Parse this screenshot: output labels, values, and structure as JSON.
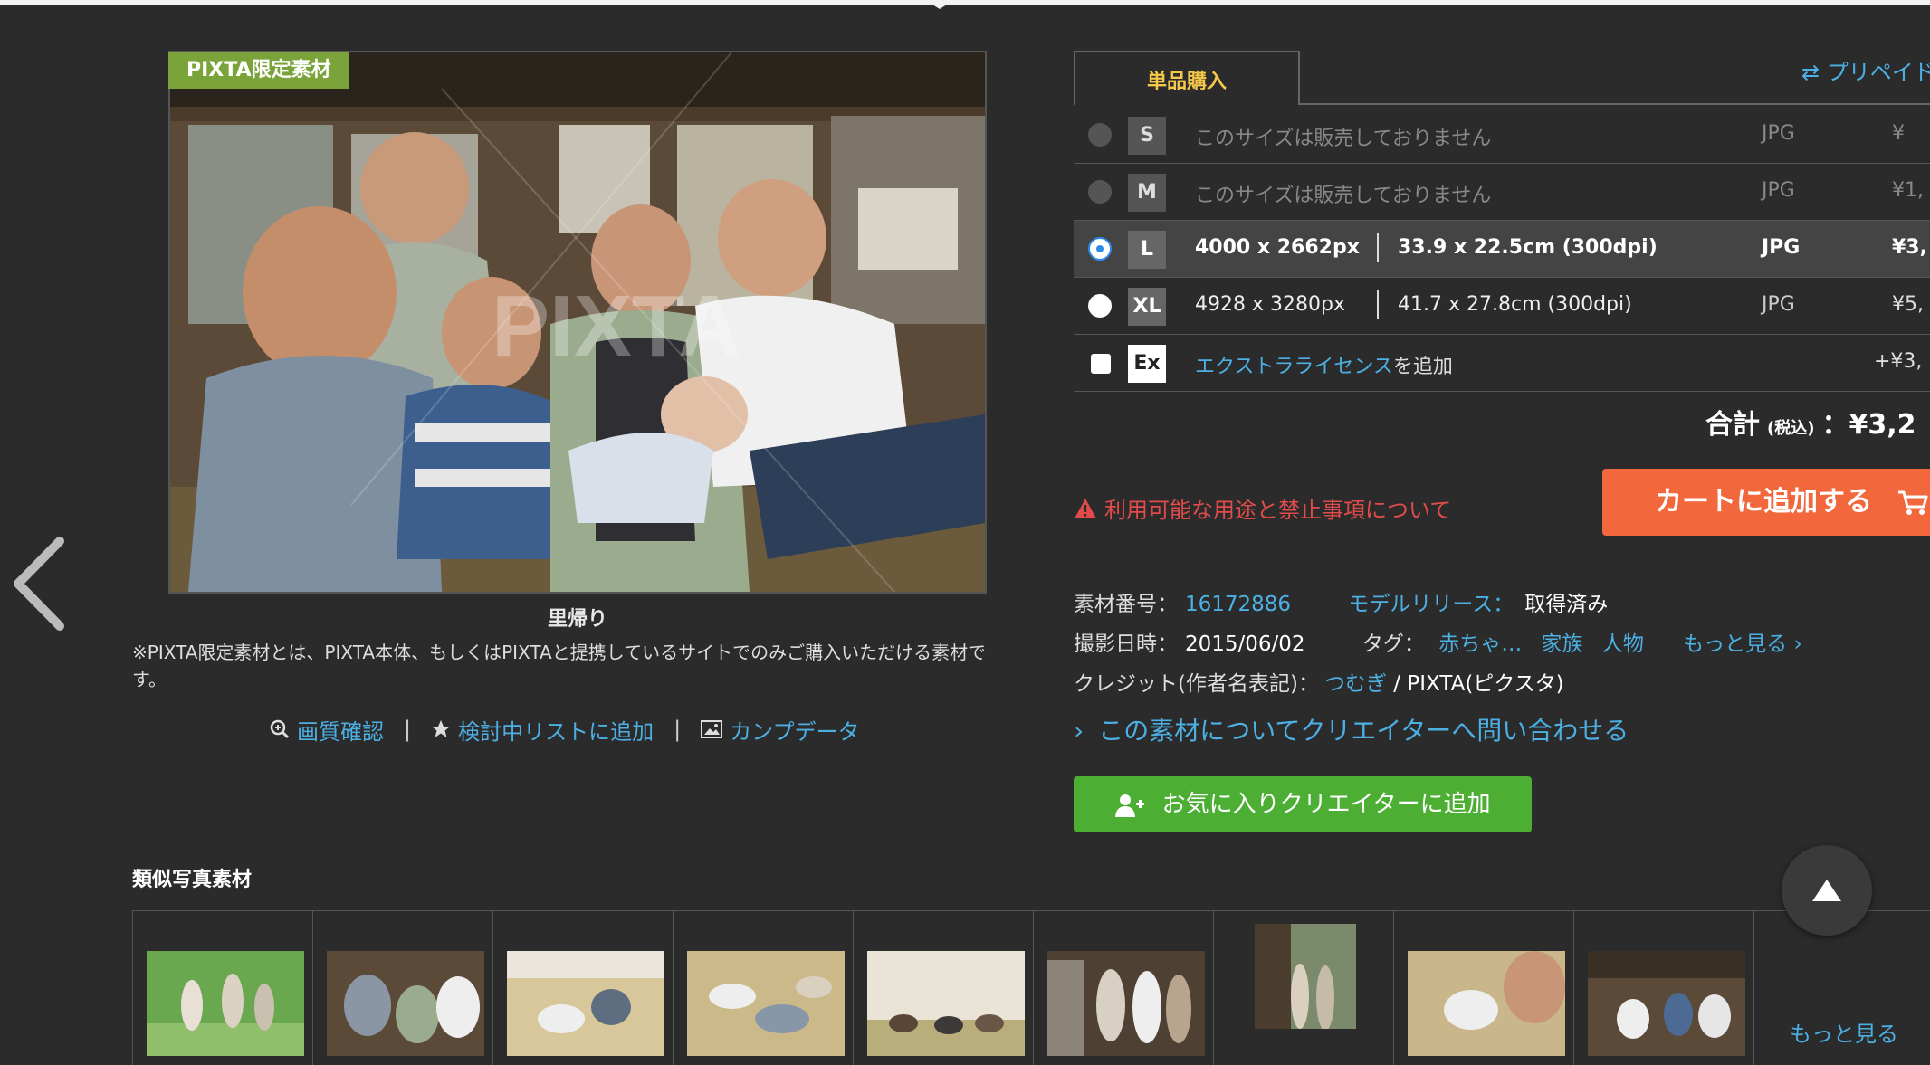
{
  "badge": "PIXTA限定素材",
  "photo": {
    "caption": "里帰り",
    "watermark": "PIXTA"
  },
  "note": "※PIXTA限定素材とは、PIXTA本体、もしくはPIXTAと提携しているサイトでのみご購入いただける素材です。",
  "actions": {
    "quality": "画質確認",
    "wishlist": "検討中リストに追加",
    "comp": "カンプデータ"
  },
  "purchase": {
    "tab": "単品購入",
    "switch_link": "⇄ プリペイド",
    "sizes": [
      {
        "size": "S",
        "desc": "このサイズは販売しておりません",
        "format": "JPG",
        "price": "¥",
        "state": "disabled"
      },
      {
        "size": "M",
        "desc": "このサイズは販売しておりません",
        "format": "JPG",
        "price": "¥1,",
        "state": "disabled"
      },
      {
        "size": "L",
        "px": "4000 x 2662px",
        "cm": "33.9 x 22.5cm (300dpi)",
        "format": "JPG",
        "price": "¥3,",
        "state": "selected"
      },
      {
        "size": "XL",
        "px": "4928 x 3280px",
        "cm": "41.7 x 27.8cm (300dpi)",
        "format": "JPG",
        "price": "¥5,",
        "state": "available"
      }
    ],
    "extra": {
      "box": "Ex",
      "link": "エクストラライセンス",
      "text": "を追加",
      "price": "+¥3,"
    },
    "total_label": "合計",
    "total_tax": "(税込)",
    "total_value": "：¥3,2",
    "warning": "利用可能な用途と禁止事項について",
    "cart_button": "カートに追加する"
  },
  "meta": {
    "id_label": "素材番号：",
    "id": "16172886",
    "release_label": "モデルリリース：",
    "release": "取得済み",
    "date_label": "撮影日時：",
    "date": "2015/06/02",
    "tag_label": "タグ：",
    "tags": [
      "赤ちゃ…",
      "家族",
      "人物"
    ],
    "more_tags": "もっと見る ›",
    "credit_label": "クレジット(作者名表記)：",
    "credit_author": "つむぎ",
    "credit_sep": " / ",
    "credit_suffix": "PIXTA(ピクスタ)"
  },
  "inquire": {
    "chevron": "›",
    "text": "この素材についてクリエイターへ問い合わせる"
  },
  "fav_button": "お気に入りクリエイターに追加",
  "similar": {
    "title": "類似写真素材",
    "more": "もっと見る"
  },
  "colors": {
    "accent": "#4cb0e4",
    "cart": "#f2673b",
    "fav": "#4cae33",
    "badge": "#7aa43a",
    "warning": "#e14b4b",
    "tab": "#f5c84a"
  }
}
